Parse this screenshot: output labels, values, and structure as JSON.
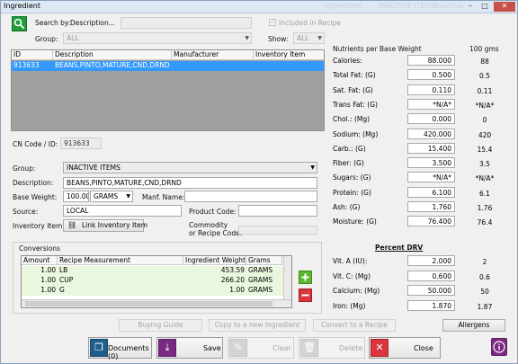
{
  "window": {
    "title": "Ingredient",
    "ghost_title": "Ingredient",
    "ghost_status": "INACTIVE ITEMS",
    "ghost_status2": "Inactive",
    "btn_min": "–",
    "btn_max": "□",
    "btn_close": "✕"
  },
  "search": {
    "label": "Search by:",
    "mode": "Description...",
    "value": "",
    "include_recipe_label": "Included in Recipe",
    "group_label": "Group:",
    "group_value": "ALL",
    "show_label": "Show:",
    "show_value": "ALL"
  },
  "results_grid": {
    "headers": [
      "ID",
      "Description",
      "Manufacturer",
      "Inventory Item"
    ],
    "rows": [
      {
        "id": "913633",
        "description": "BEANS,PINTO,MATURE,CND,DRND",
        "manufacturer": "",
        "inventory_item": ""
      }
    ]
  },
  "details": {
    "cn_code_label": "CN Code / ID:",
    "cn_code_value": "913633",
    "group_label": "Group:",
    "group_value": "INACTIVE ITEMS",
    "description_label": "Description:",
    "description_value": "BEANS,PINTO,MATURE,CND,DRND",
    "base_weight_label": "Base Weight:",
    "base_weight_value": "100.00",
    "base_weight_unit": "GRAMS",
    "manf_name_label": "Manf. Name:",
    "manf_name_value": "",
    "source_label": "Source:",
    "source_value": "LOCAL",
    "product_code_label": "Product Code:",
    "product_code_value": "",
    "inventory_item_label": "Inventory Item:",
    "link_inventory_label": "Link Inventory Item",
    "commodity_label_1": "Commodity",
    "commodity_label_2": "or Recipe Code:",
    "commodity_value": ""
  },
  "conversions": {
    "title": "Conversions",
    "headers": [
      "Amount",
      "Recipe Measurement",
      "Ingredient Weight",
      "Grams"
    ],
    "rows": [
      {
        "amount": "1.00",
        "measure": "LB",
        "weight": "453.59",
        "unit": "GRAMS"
      },
      {
        "amount": "1.00",
        "measure": "CUP",
        "weight": "266.20",
        "unit": "GRAMS"
      },
      {
        "amount": "1.00",
        "measure": "G",
        "weight": "1.00",
        "unit": "GRAMS"
      }
    ],
    "add_icon": "plus-icon",
    "remove_icon": "minus-icon"
  },
  "nutrients": {
    "header": "Nutrients per Base Weight",
    "ref_header": "100 gms",
    "items": [
      {
        "label": "Calories:",
        "value": "88.000",
        "ref": "88"
      },
      {
        "label": "Total Fat: (G)",
        "value": "0.500",
        "ref": "0.5"
      },
      {
        "label": "Sat. Fat: (G)",
        "value": "0.110",
        "ref": "0.11"
      },
      {
        "label": "Trans Fat: (G)",
        "value": "*N/A*",
        "ref": "*N/A*"
      },
      {
        "label": "Chol.: (Mg)",
        "value": "0.000",
        "ref": "0"
      },
      {
        "label": "Sodium: (Mg)",
        "value": "420.000",
        "ref": "420"
      },
      {
        "label": "Carb.: (G)",
        "value": "15.400",
        "ref": "15.4"
      },
      {
        "label": "Fiber: (G)",
        "value": "3.500",
        "ref": "3.5"
      },
      {
        "label": "Sugars: (G)",
        "value": "*N/A*",
        "ref": "*N/A*"
      },
      {
        "label": "Protein: (G)",
        "value": "6.100",
        "ref": "6.1"
      },
      {
        "label": "Ash: (G)",
        "value": "1.760",
        "ref": "1.76"
      },
      {
        "label": "Moisture: (G)",
        "value": "76.400",
        "ref": "76.4"
      }
    ],
    "drv_header": "Percent DRV",
    "drv_items": [
      {
        "label": "Vit. A (IU):",
        "value": "2.000",
        "ref": "2"
      },
      {
        "label": "Vit. C: (Mg)",
        "value": "0.600",
        "ref": "0.6"
      },
      {
        "label": "Calcium: (Mg)",
        "value": "50.000",
        "ref": "50"
      },
      {
        "label": "Iron: (Mg)",
        "value": "1.870",
        "ref": "1.87"
      }
    ]
  },
  "actions": {
    "buying_guide": "Buying Guide",
    "copy_new": "Copy to a new Ingredient",
    "convert_recipe": "Convert to a Recipe",
    "allergens": "Allergens",
    "documents": "Documents (0)",
    "save": "Save",
    "clear": "Clear",
    "delete": "Delete",
    "close": "Close",
    "info_icon": "info-icon"
  },
  "colors": {
    "selection": "#3399ff",
    "grid_empty": "#a0a0a0",
    "conversion_row": "#e9f7df",
    "add_green": "#5cb82e",
    "remove_red": "#d9363e",
    "search_green": "#1e9c3a",
    "info_purple": "#7b2a83"
  }
}
